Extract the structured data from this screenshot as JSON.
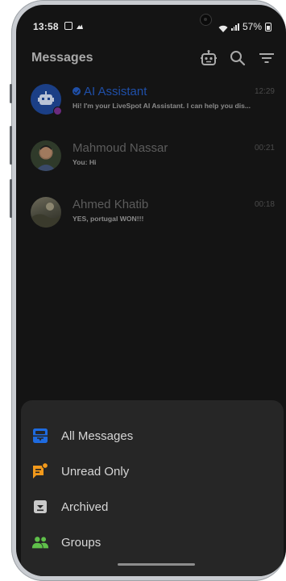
{
  "status_bar": {
    "time": "13:58",
    "battery": "57%"
  },
  "app_bar": {
    "title": "Messages",
    "icons": [
      "robot-icon",
      "search-icon",
      "filter-icon"
    ]
  },
  "chats": [
    {
      "name": "AI Assistant",
      "time": "12:29",
      "preview": "Hi! I'm your LiveSpot AI Assistant. I can help you dis...",
      "verified": true,
      "accent_color": "#1f4fa8"
    },
    {
      "name": "Mahmoud Nassar",
      "time": "00:21",
      "preview": "You: Hi"
    },
    {
      "name": "Ahmed Khatib",
      "time": "00:18",
      "preview": "YES, portugal WON!!!"
    }
  ],
  "filter_menu": {
    "items": [
      {
        "label": "All Messages",
        "icon": "inbox-icon",
        "color": "#1e6be0"
      },
      {
        "label": "Unread Only",
        "icon": "unread-chat-icon",
        "color": "#f2991b"
      },
      {
        "label": "Archived",
        "icon": "archive-icon",
        "color": "#c9c9c9"
      },
      {
        "label": "Groups",
        "icon": "groups-icon",
        "color": "#5fc04a"
      }
    ]
  }
}
